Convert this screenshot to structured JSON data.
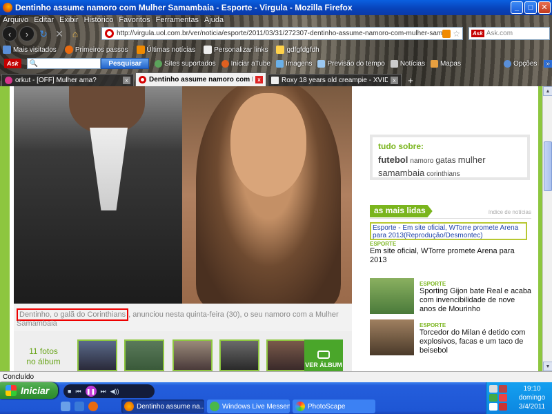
{
  "window": {
    "title": "Dentinho assume namoro com Mulher Samambaia - Esporte - Virgula - Mozilla Firefox",
    "min": "_",
    "max": "□",
    "close": "✕"
  },
  "menu": [
    "Arquivo",
    "Editar",
    "Exibir",
    "Histórico",
    "Favoritos",
    "Ferramentas",
    "Ajuda"
  ],
  "nav": {
    "back": "‹",
    "forward": "›",
    "reload": "↻",
    "stop": "✕",
    "home": "⌂",
    "url": "http://virgula.uol.com.br/ver/noticia/esporte/2011/03/31/272307-dentinho-assume-namoro-com-mulher-samambaia",
    "search_placeholder": "Ask.com",
    "search_logo": "Ask",
    "star": "☆"
  },
  "bookmarks": [
    "Mais visitados",
    "Primeiros passos",
    "Últimas notícias",
    "Personalizar links",
    "gdfgfdgfdh"
  ],
  "ask_toolbar": {
    "brand": "Ask",
    "search_icon": "🔍",
    "search_button": "Pesquisar",
    "items": [
      "Sites suportados",
      "Iniciar aTube",
      "Imagens",
      "Previsão do tempo",
      "Notícias",
      "Mapas"
    ],
    "options": "Opções",
    "more": "»"
  },
  "tabs": [
    {
      "label": "orkut - [OFF] Mulher ama?",
      "active": false
    },
    {
      "label": "Dentinho assume namoro com M...",
      "active": true
    },
    {
      "label": "Roxy 18 years old creampie - XVIDEOS....",
      "active": false
    }
  ],
  "tab_close": "x",
  "new_tab": "+",
  "article": {
    "caption_highlight": "Dentinho, o galã do Corinthians",
    "caption_rest": ", anunciou nesta quinta-feira (30), o seu namoro com a Mulher Samambaia",
    "gallery_label": "11 fotos no álbum",
    "view_all": "VER ÁLBUM"
  },
  "sidebar": {
    "tudo_title": "tudo sobre:",
    "tags": [
      {
        "text": "futebol",
        "size": "big"
      },
      {
        "text": "namoro",
        "size": "small"
      },
      {
        "text": "gatas",
        "size": "small"
      },
      {
        "text": "mulher",
        "size": "big"
      },
      {
        "text": "samambaia",
        "size": "big"
      },
      {
        "text": "corinthians",
        "size": "small"
      }
    ],
    "mais_lidas": "as mais lidas",
    "indice": "índice de notícias",
    "top_link": "Esporte - Em site oficial, WTorre promete Arena para 2013(Reprodução/Desmontec)",
    "news": [
      {
        "cat": "ESPORTE",
        "headline": "Em site oficial, WTorre promete Arena para 2013"
      },
      {
        "cat": "ESPORTE",
        "headline": "Sporting Gijon bate Real e acaba com invencibilidade de nove anos de Mourinho"
      },
      {
        "cat": "ESPORTE",
        "headline": "Torcedor do Milan é detido com explosivos, facas e um taco de beisebol"
      }
    ]
  },
  "status": "Concluído",
  "taskbar": {
    "start": "Iniciar",
    "tasks": [
      "Dentinho assume na...",
      "Windows Live Messen...",
      "PhotoScape"
    ],
    "clock_time": "19:10",
    "clock_day": "domingo",
    "clock_date": "3/4/2011"
  },
  "colors": {
    "accent_green": "#7ab51d",
    "page_bg_green": "#8dc63f",
    "link_blue": "#1e42a8",
    "highlight_red": "#e00000"
  }
}
